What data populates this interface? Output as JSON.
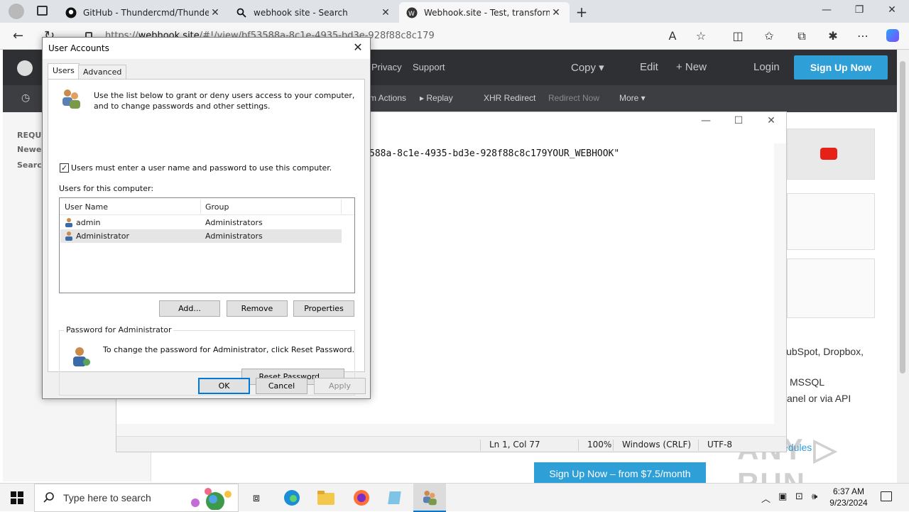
{
  "browser": {
    "tabs": [
      {
        "title": "GitHub - Thundercmd/ThunderS",
        "icon": "github-icon"
      },
      {
        "title": "webhook site - Search",
        "icon": "search-icon"
      },
      {
        "title": "Webhook.site - Test, transform ar",
        "icon": "webhook-icon"
      }
    ],
    "url_prefix": "https://",
    "url_host": "webhook.site",
    "url_path": "/#!/view/bf53588a-8c1e-4935-bd3e-928f88c8c179"
  },
  "site": {
    "nav": {
      "privacy": "Privacy",
      "support": "Support",
      "copy": "Copy ▾",
      "edit": "Edit",
      "new": "+ New",
      "login": "Login",
      "signup": "Sign Up Now"
    },
    "subnav": {
      "actions": "m Actions",
      "replay": "▸ Replay",
      "xhr": "XHR Redirect",
      "redirect_now": "Redirect Now",
      "more": "More ▾"
    },
    "sidebar": {
      "requests": "REQUES",
      "newest": "Newes",
      "search": "Search"
    },
    "right_text": {
      "line1": "lubSpot, Dropbox,",
      "line2": "MSSQL",
      "line3": "anel or via API",
      "schedules": "edules"
    },
    "signup_bottom": "Sign Up Now – from $7.5/month",
    "watermark": "ANY ▷ RUN"
  },
  "notepad": {
    "text": "588a-8c1e-4935-bd3e-928f88c8c179YOUR_WEBHOOK\"",
    "status": {
      "position": "Ln 1, Col 77",
      "zoom": "100%",
      "line_endings": "Windows (CRLF)",
      "encoding": "UTF-8"
    }
  },
  "dialog": {
    "title": "User Accounts",
    "tabs": [
      "Users",
      "Advanced"
    ],
    "intro_line1": "Use the list below to grant or deny users access to your computer,",
    "intro_line2": "and to change passwords and other settings.",
    "checkbox_label": "Users must enter a user name and password to use this computer.",
    "checkbox_checked": true,
    "users_label": "Users for this computer:",
    "columns": [
      "User Name",
      "Group"
    ],
    "users": [
      {
        "name": "admin",
        "group": "Administrators"
      },
      {
        "name": "Administrator",
        "group": "Administrators"
      }
    ],
    "buttons": {
      "add": "Add...",
      "remove": "Remove",
      "properties": "Properties",
      "reset_password": "Reset Password...",
      "ok": "OK",
      "cancel": "Cancel",
      "apply": "Apply"
    },
    "password_group": "Password for Administrator",
    "password_text": "To change the password for Administrator, click Reset Password."
  },
  "taskbar": {
    "search_placeholder": "Type here to search",
    "time": "6:37 AM",
    "date": "9/23/2024"
  },
  "colors": {
    "accent": "#0078d7",
    "site_blue": "#2f9fd8",
    "site_dark": "#2f3033"
  }
}
